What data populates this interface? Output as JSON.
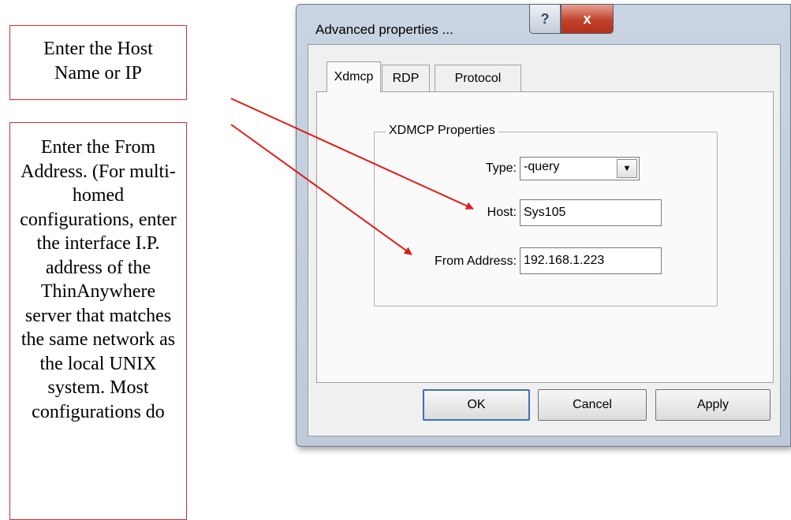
{
  "callouts": {
    "host_text": "Enter the Host\nName or IP",
    "from_text": "Enter the From Address.  (For multi-homed configurations, enter the interface I.P. address of the ThinAnywhere server that matches the same network as the local UNIX system.  Most configurations do"
  },
  "dialog": {
    "title": "Advanced properties ...",
    "help_glyph": "?",
    "close_glyph": "x",
    "tabs": [
      "Xdmcp",
      "RDP",
      "Protocol"
    ],
    "group_title": "XDMCP Properties",
    "type_label": "Type:",
    "type_value": "-query",
    "host_label": "Host:",
    "host_value": "Sys105",
    "from_label": "From Address:",
    "from_value": "192.168.1.223",
    "buttons": {
      "ok": "OK",
      "cancel": "Cancel",
      "apply": "Apply"
    }
  },
  "colors": {
    "callout_border": "#d92b2b",
    "arrow": "#e31b1b",
    "window_frame": "#c9d4e2"
  }
}
